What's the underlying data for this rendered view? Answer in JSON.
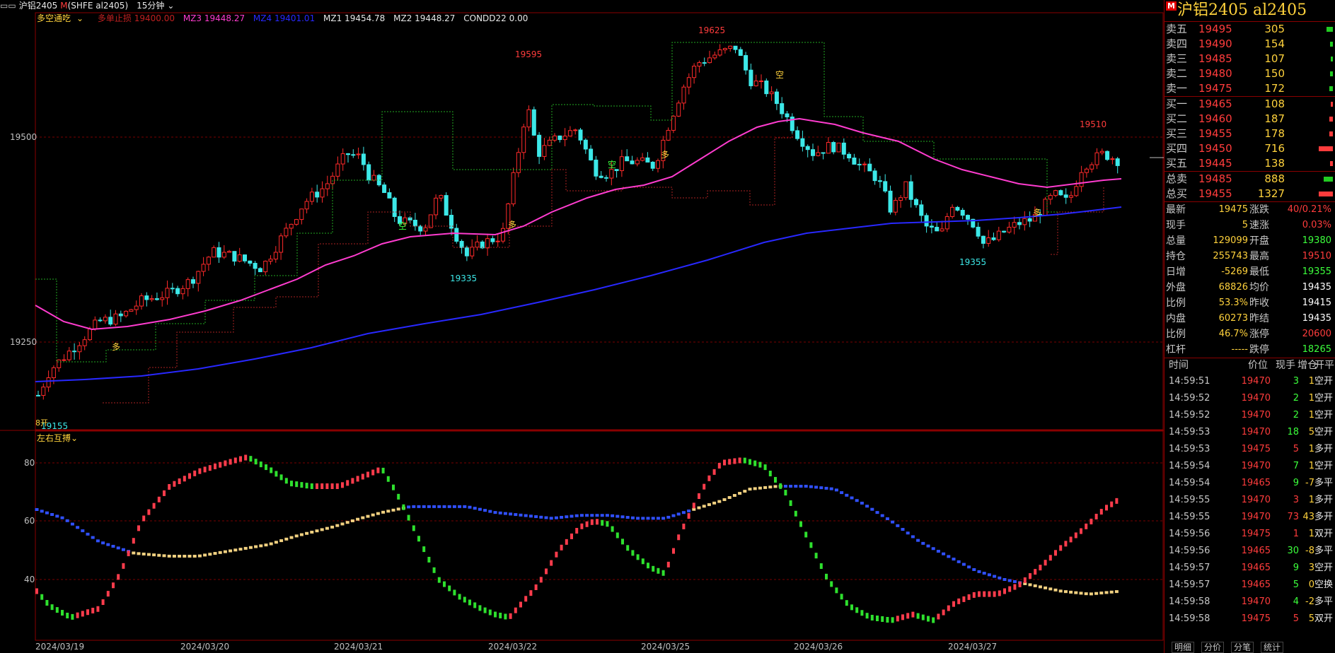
{
  "title_bar": {
    "symbol": "沪铝2405",
    "marker": "M",
    "code": "(SHFE al2405)",
    "period": "15分钟"
  },
  "indicator": {
    "name": "多空通吃",
    "stop": "多单止损 19400.00",
    "mz3": "MZ3 19448.27",
    "mz4": "MZ4 19401.01",
    "mz1": "MZ1 19454.78",
    "mz2": "MZ2 19448.27",
    "cond": "CONDD22 0.00"
  },
  "sub_indicator": {
    "name": "左右互搏"
  },
  "price_axis": {
    "upper": "19500",
    "lower": "19250"
  },
  "sub_axis": {
    "l80": "80",
    "l60": "60",
    "l40": "40"
  },
  "dates": [
    "2024/03/19",
    "2024/03/20",
    "2024/03/21",
    "2024/03/22",
    "2024/03/25",
    "2024/03/26",
    "2024/03/27"
  ],
  "annotations": {
    "hi1": "19595",
    "hi2": "19625",
    "hi3": "19510",
    "lo1": "19155",
    "lo2": "19335",
    "lo3": "19355",
    "duo": "多",
    "kong": "空",
    "low_tag": "8开"
  },
  "colors": {
    "up": "#ff2a2a",
    "down": "#3ce8e8",
    "ma_short": "#ff3ccf",
    "ma_long": "#2828ff",
    "grid": "#7a0000"
  },
  "panel": {
    "marker": "M",
    "title": "沪铝2405  al2405",
    "asks": [
      {
        "label": "卖五",
        "price": "19495",
        "vol": "305"
      },
      {
        "label": "卖四",
        "price": "19490",
        "vol": "154"
      },
      {
        "label": "卖三",
        "price": "19485",
        "vol": "107"
      },
      {
        "label": "卖二",
        "price": "19480",
        "vol": "150"
      },
      {
        "label": "卖一",
        "price": "19475",
        "vol": "172"
      }
    ],
    "bids": [
      {
        "label": "买一",
        "price": "19465",
        "vol": "108"
      },
      {
        "label": "买二",
        "price": "19460",
        "vol": "187"
      },
      {
        "label": "买三",
        "price": "19455",
        "vol": "178"
      },
      {
        "label": "买四",
        "price": "19450",
        "vol": "716"
      },
      {
        "label": "买五",
        "price": "19445",
        "vol": "138"
      }
    ],
    "totals": [
      {
        "label": "总卖",
        "price": "19485",
        "vol": "888"
      },
      {
        "label": "总买",
        "price": "19455",
        "vol": "1327"
      }
    ],
    "quote": [
      {
        "l1": "最新",
        "v1": "19475",
        "l2": "涨跌",
        "v2": "40/0.21%"
      },
      {
        "l1": "现手",
        "v1": "5",
        "l2": "速涨",
        "v2": "0.03%"
      },
      {
        "l1": "总量",
        "v1": "129099",
        "l2": "开盘",
        "v2": "19380"
      },
      {
        "l1": "持仓",
        "v1": "255743",
        "l2": "最高",
        "v2": "19510"
      },
      {
        "l1": "日增",
        "v1": "-5269",
        "l2": "最低",
        "v2": "19355"
      },
      {
        "l1": "外盘",
        "v1": "68826",
        "l2": "均价",
        "v2": "19435"
      },
      {
        "l1": "比例",
        "v1": "53.3%",
        "l2": "昨收",
        "v2": "19415"
      },
      {
        "l1": "内盘",
        "v1": "60273",
        "l2": "昨结",
        "v2": "19435"
      },
      {
        "l1": "比例",
        "v1": "46.7%",
        "l2": "涨停",
        "v2": "20600"
      },
      {
        "l1": "杠杆",
        "v1": "-----",
        "l2": "跌停",
        "v2": "18265"
      }
    ],
    "tick_head": {
      "time": "时间",
      "price": "价位",
      "qty": "现手",
      "delta": "增仓",
      "kind": "开平"
    },
    "ticks": [
      {
        "t": "14:59:51",
        "p": "19470",
        "q": "3",
        "d": "1",
        "k": "空开",
        "c": "#3cff3c"
      },
      {
        "t": "14:59:52",
        "p": "19470",
        "q": "2",
        "d": "1",
        "k": "空开",
        "c": "#3cff3c"
      },
      {
        "t": "14:59:52",
        "p": "19470",
        "q": "2",
        "d": "1",
        "k": "空开",
        "c": "#3cff3c"
      },
      {
        "t": "14:59:53",
        "p": "19470",
        "q": "18",
        "d": "5",
        "k": "空开",
        "c": "#3cff3c"
      },
      {
        "t": "14:59:53",
        "p": "19475",
        "q": "5",
        "d": "1",
        "k": "多开",
        "c": "#ff3c3c"
      },
      {
        "t": "14:59:54",
        "p": "19470",
        "q": "7",
        "d": "1",
        "k": "空开",
        "c": "#3cff3c"
      },
      {
        "t": "14:59:54",
        "p": "19465",
        "q": "9",
        "d": "-7",
        "k": "多平",
        "c": "#3cff3c"
      },
      {
        "t": "14:59:55",
        "p": "19470",
        "q": "3",
        "d": "1",
        "k": "多开",
        "c": "#ff3c3c"
      },
      {
        "t": "14:59:55",
        "p": "19470",
        "q": "73",
        "d": "43",
        "k": "多开",
        "c": "#ff3c3c"
      },
      {
        "t": "14:59:56",
        "p": "19475",
        "q": "1",
        "d": "1",
        "k": "双开",
        "c": "#ff3c3c"
      },
      {
        "t": "14:59:56",
        "p": "19465",
        "q": "30",
        "d": "-8",
        "k": "多平",
        "c": "#3cff3c"
      },
      {
        "t": "14:59:57",
        "p": "19465",
        "q": "9",
        "d": "3",
        "k": "空开",
        "c": "#3cff3c"
      },
      {
        "t": "14:59:57",
        "p": "19465",
        "q": "5",
        "d": "0",
        "k": "空换",
        "c": "#3cff3c"
      },
      {
        "t": "14:59:58",
        "p": "19470",
        "q": "4",
        "d": "-2",
        "k": "多平",
        "c": "#3cff3c"
      },
      {
        "t": "14:59:58",
        "p": "19475",
        "q": "5",
        "d": "5",
        "k": "双开",
        "c": "#ff3c3c"
      }
    ],
    "tabs": [
      "明细",
      "分价",
      "分笔",
      "统计"
    ]
  }
}
